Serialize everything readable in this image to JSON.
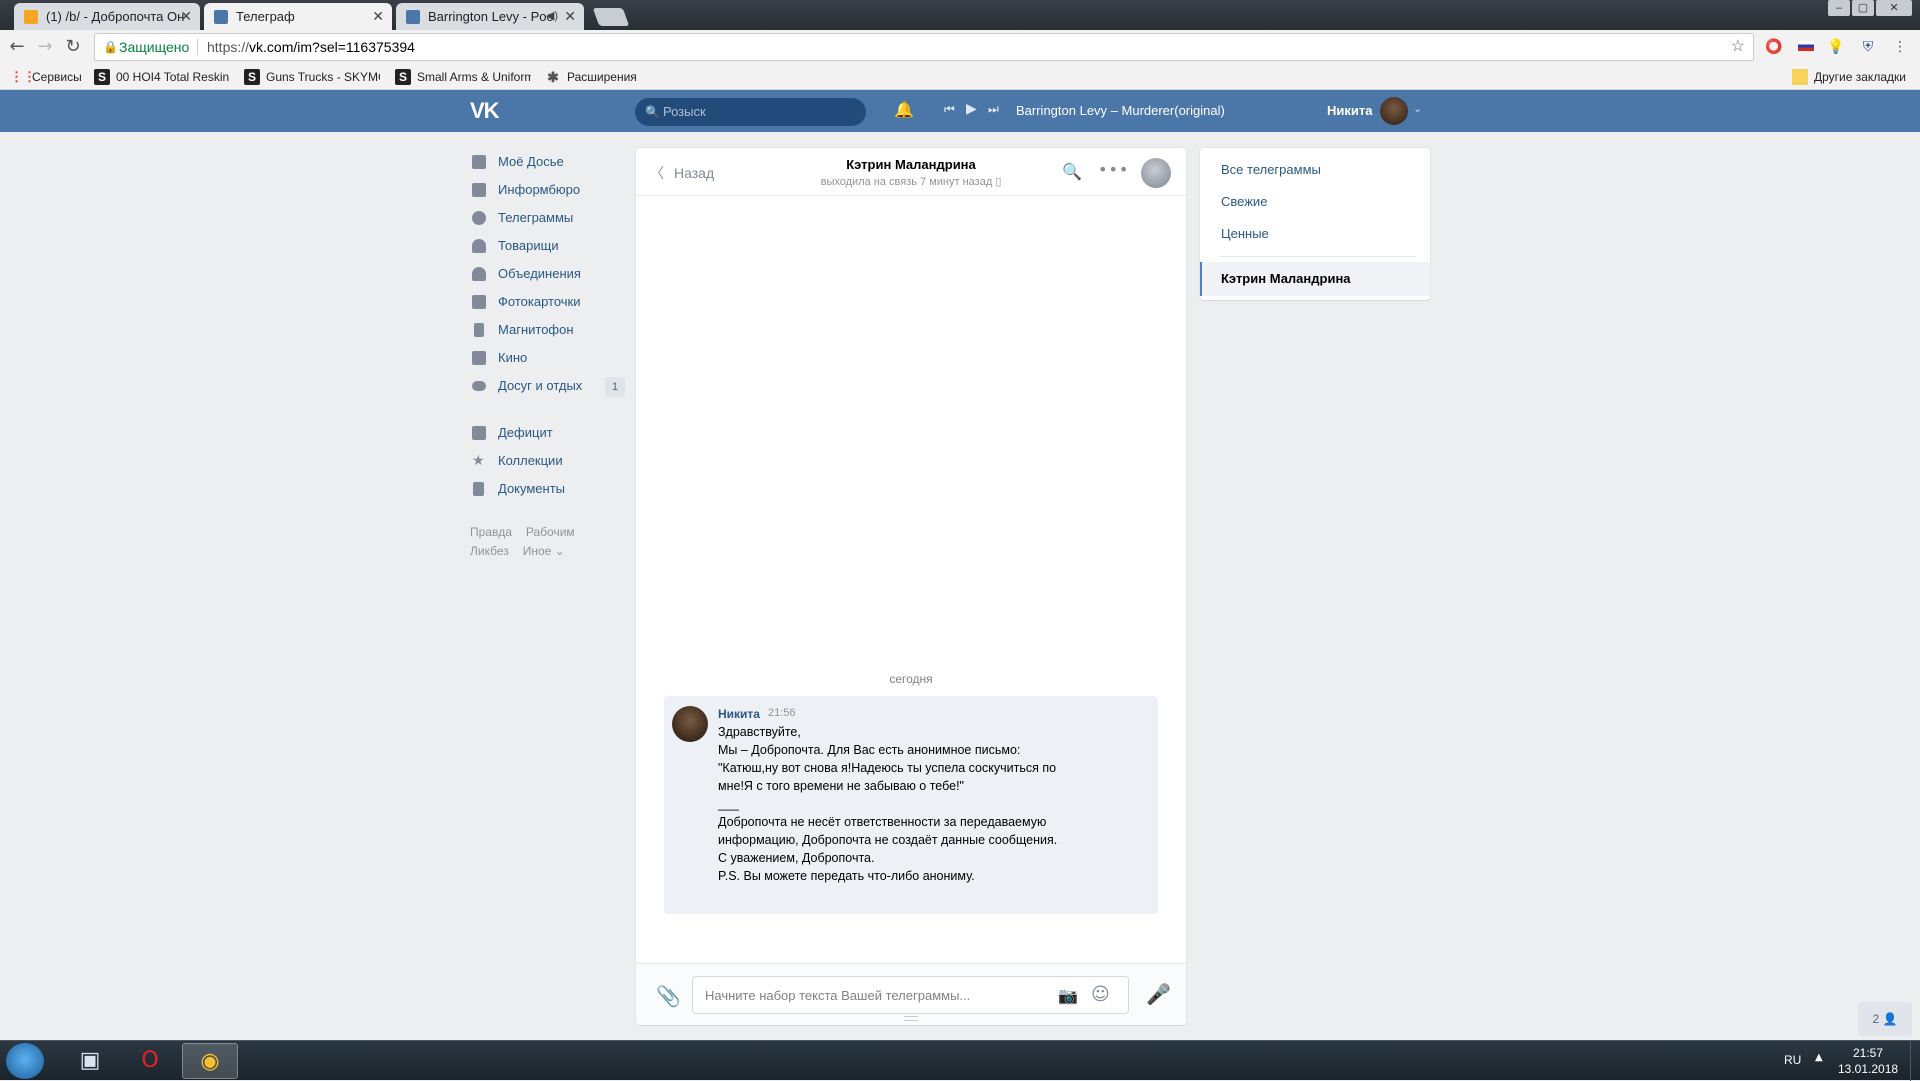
{
  "browser": {
    "tabs": [
      {
        "title": "(1) /b/ - Добропочта Он",
        "icon_color": "#f5a623",
        "active": false
      },
      {
        "title": "Телеграф",
        "icon_color": "#4a76a8",
        "active": true
      },
      {
        "title": "Barrington Levy - Poo",
        "icon_color": "#4a76a8",
        "active": false
      }
    ],
    "window_controls": [
      "–",
      "▢",
      "✕"
    ],
    "secure_label": "Защищено",
    "url_prefix": "https://",
    "url_main": "vk.com/im?sel=116375394",
    "bookmarks": [
      {
        "label": "Сервисы",
        "icon": "apps-grid-icon"
      },
      {
        "label": "00 HOI4 Total Reskin",
        "icon": "steam-s-icon"
      },
      {
        "label": "Guns Trucks - SKYMO",
        "icon": "steam-s-icon"
      },
      {
        "label": "Small Arms & Uniform",
        "icon": "steam-s-icon"
      },
      {
        "label": "Расширения",
        "icon": "puzzle-icon"
      }
    ],
    "other_bookmarks": "Другие закладки"
  },
  "header": {
    "search_placeholder": "Розыск",
    "track": "Barrington Levy – Murderer(original)",
    "user_name": "Никита",
    "brand_color": "#4a76a8"
  },
  "menu": {
    "items": [
      {
        "label": "Моё Досье",
        "icon": "home-icon"
      },
      {
        "label": "Информбюро",
        "icon": "news-icon"
      },
      {
        "label": "Телеграммы",
        "icon": "messages-icon"
      },
      {
        "label": "Товарищи",
        "icon": "friends-icon"
      },
      {
        "label": "Объединения",
        "icon": "groups-icon"
      },
      {
        "label": "Фотокарточки",
        "icon": "camera-icon"
      },
      {
        "label": "Магнитофон",
        "icon": "music-icon"
      },
      {
        "label": "Кино",
        "icon": "video-icon"
      },
      {
        "label": "Досуг и отдых",
        "icon": "gamepad-icon",
        "count": "1"
      }
    ],
    "items2": [
      {
        "label": "Дефицит",
        "icon": "bag-icon"
      },
      {
        "label": "Коллекции",
        "icon": "star-icon"
      },
      {
        "label": "Документы",
        "icon": "document-icon"
      }
    ],
    "footer": {
      "rules": "Правда",
      "jobs": "Рабочим",
      "education": "Ликбез",
      "more": "Иное ⌄"
    }
  },
  "chat": {
    "back": "Назад",
    "peer_name": "Кэтрин Маландрина",
    "peer_status": "выходила на связь 7 минут назад",
    "date_separator": "сегодня",
    "message": {
      "author": "Никита",
      "time": "21:56",
      "lines": [
        "Здравствуйте,",
        "Мы – Добропочта. Для Вас есть анонимное письмо:",
        "\"Катюш,ну вот снова я!Надеюсь ты успела соскучиться по",
        "мне!Я с того времени не забываю о тебе!\"",
        "___",
        "Добропочта не несёт ответственности за передаваемую",
        "информацию, Добропочта не создаёт данные сообщения.",
        "",
        "С уважением, Добропочта.",
        "P.S. Вы можете передать что-либо анониму."
      ]
    },
    "input_placeholder": "Начните набор текста Вашей телеграммы..."
  },
  "folders": {
    "all": "Все телеграммы",
    "fresh": "Свежие",
    "important": "Ценные",
    "active_chat": "Кэтрин Маландрина"
  },
  "online_widget": "2 👤",
  "taskbar": {
    "lang": "RU",
    "time": "21:57",
    "date": "13.01.2018"
  }
}
